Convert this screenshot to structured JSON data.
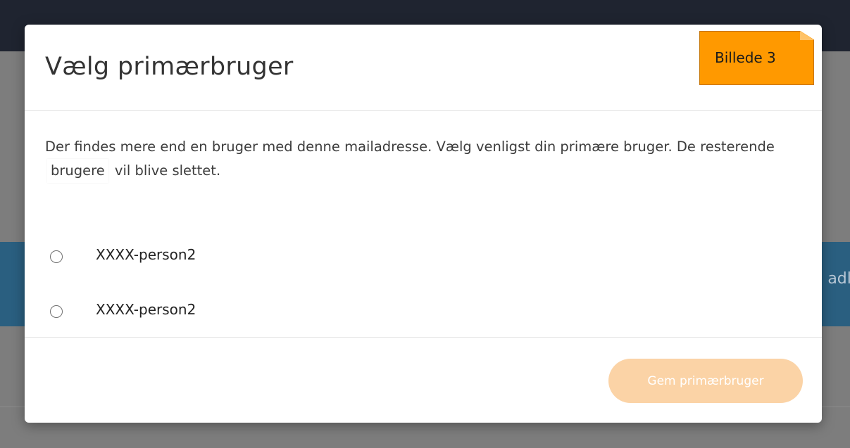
{
  "background": {
    "partial_text": "adli"
  },
  "modal": {
    "title": "Vælg primærbruger",
    "tag_label": "Billede 3",
    "description_part1": "Der findes mere end en bruger med denne mailadresse. Vælg venligst din primære bruger. De resterende",
    "description_highlight": "brugere",
    "description_part2": "vil blive slettet.",
    "options": [
      {
        "label": "XXXX-person2",
        "selected": false
      },
      {
        "label": "XXXX-person2",
        "selected": false
      }
    ],
    "save_button_label": "Gem primærbruger",
    "save_button_disabled": true
  },
  "colors": {
    "accent": "#ff9900",
    "button_disabled": "#fbd3a6",
    "topbar": "#1f2430",
    "band": "#2a5f80"
  },
  "icons": {
    "radio": "radio-unchecked-icon"
  }
}
